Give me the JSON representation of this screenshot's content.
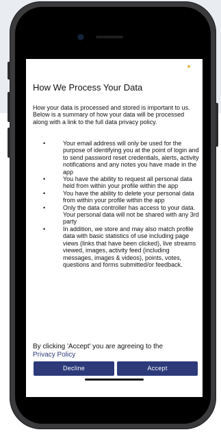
{
  "dialog": {
    "title": "How We Process Your Data",
    "intro": "How your data is processed and stored is important to us. Below is a summary of how your data will be processed along with a link to the full data privacy policy.",
    "bullet_symbol": "•",
    "bullets": [
      "Your email address will only be used for the purpose of identifying you at the point of login and to send password reset credentials, alerts, activity notifications and any notes you have made in the app",
      "You have the ability to request all personal data held from within your profile within the app",
      "You have the ability to delete your personal data from within your profile within the app",
      "Only the data controller has access to your data. Your personal data will not be shared with any 3rd party",
      "In addition, we store and may also match profile data with basic statistics of use including page views (links that have been clicked), live streams viewed, images, activity feed (including messages, images & videos), points, votes, questions and forms submitted/or feedback."
    ],
    "consent_text": "By clicking 'Accept' you are agreeing to the",
    "policy_link": "Privacy Policy",
    "decline_label": "Decline",
    "accept_label": "Accept"
  },
  "colors": {
    "button": "#2c3a7a",
    "link": "#2c3a7a",
    "indicator_dot": "#e8b64a",
    "background_panel": "#e9ecf1"
  }
}
